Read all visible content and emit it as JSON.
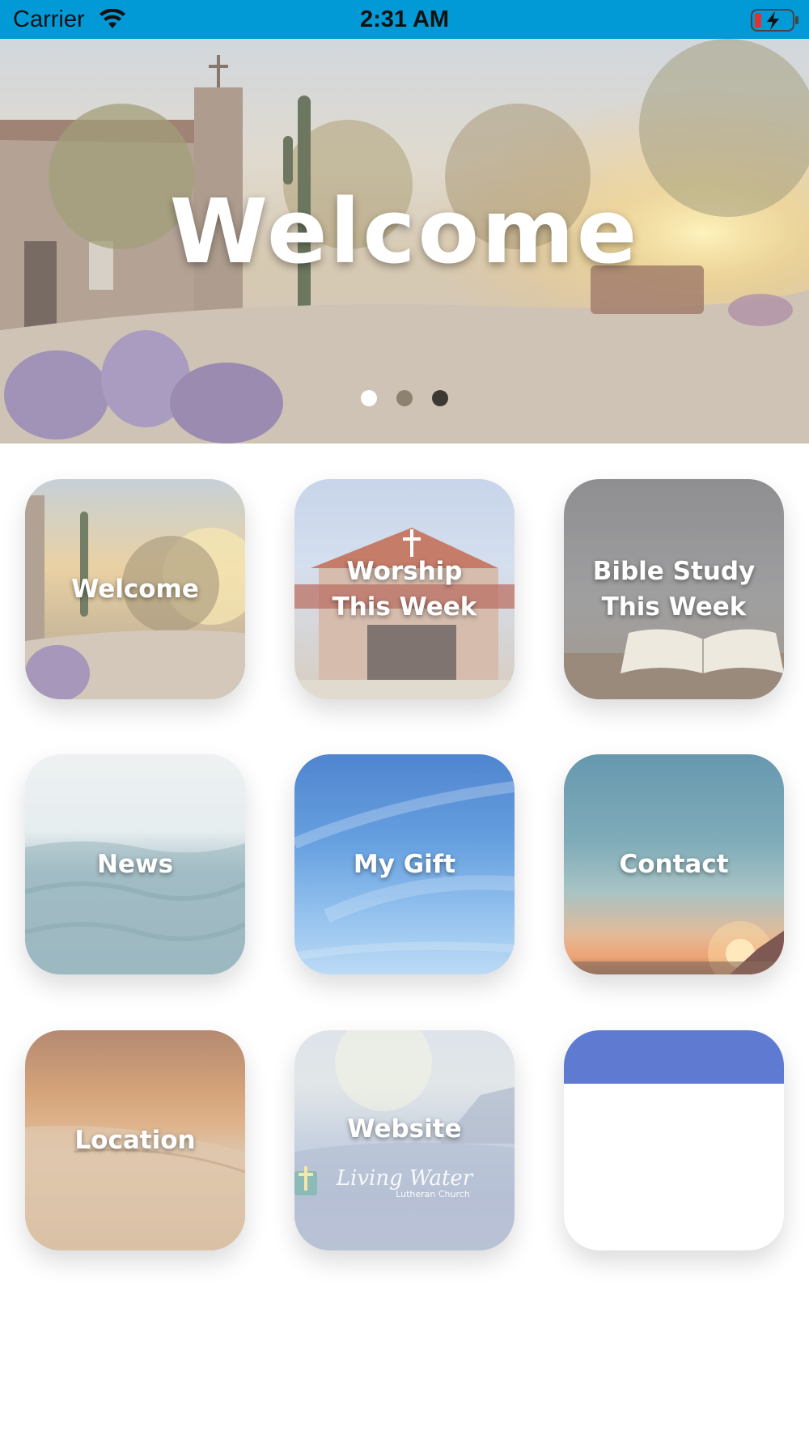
{
  "status_bar": {
    "carrier": "Carrier",
    "time": "2:31 AM",
    "background": "#029ad6"
  },
  "hero": {
    "title": "Welcome",
    "page_count": 3,
    "active_page": 1
  },
  "tiles": [
    {
      "label": "Welcome"
    },
    {
      "label": "Worship\nThis Week"
    },
    {
      "label": "Bible Study\nThis Week"
    },
    {
      "label": "News"
    },
    {
      "label": "My Gift"
    },
    {
      "label": "Contact"
    },
    {
      "label": "Location"
    },
    {
      "label": "Website",
      "logo_text": "Living Water",
      "logo_sub": "Lutheran Church"
    },
    {
      "label": ""
    }
  ],
  "icons": [
    "wifi-icon",
    "battery-charging-icon",
    "cross-logo-icon"
  ]
}
